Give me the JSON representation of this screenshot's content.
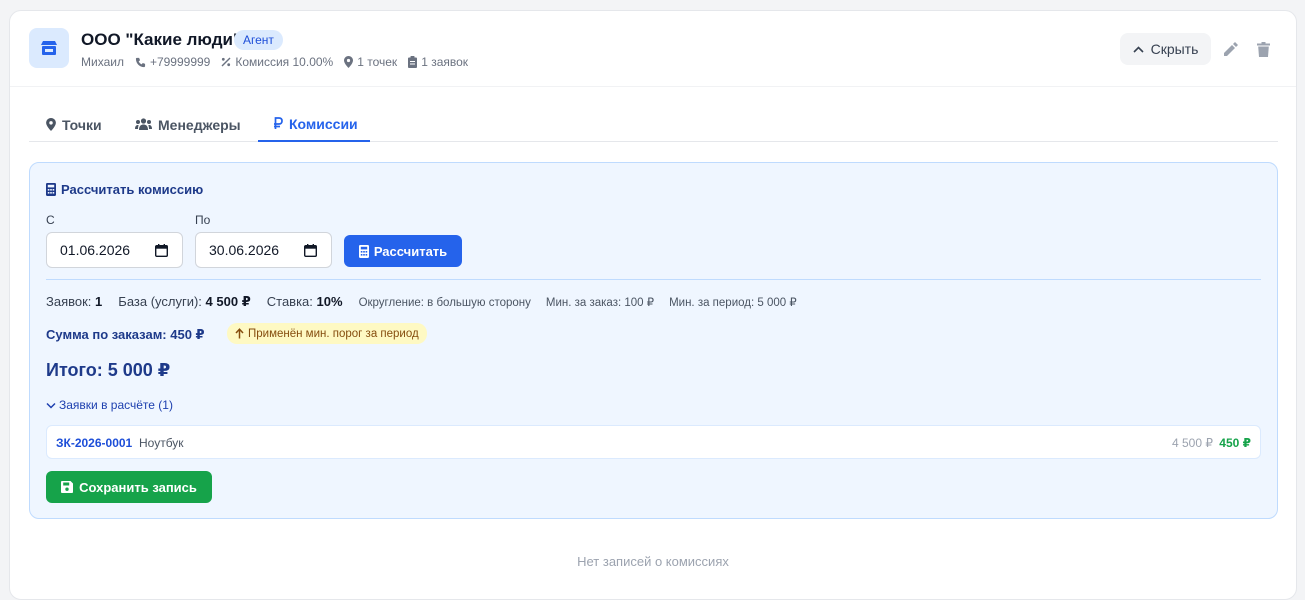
{
  "header": {
    "title": "ООО \"Какие люди\"",
    "badge": "Агент",
    "meta": {
      "contact": "Михаил",
      "phone": "+79999999",
      "commission": "Комиссия 10.00%",
      "points": "1 точек",
      "orders": "1 заявок"
    },
    "hide_label": "Скрыть"
  },
  "tabs": [
    {
      "label": "Точки",
      "icon": "map-pin-icon"
    },
    {
      "label": "Менеджеры",
      "icon": "users-icon"
    },
    {
      "label": "Комиссии",
      "icon": "ruble-icon",
      "active": true
    }
  ],
  "calc": {
    "title": "Рассчитать комиссию",
    "from_label": "С",
    "from_value": "01.06.2026",
    "to_label": "По",
    "to_value": "30.06.2026",
    "calc_button": "Рассчитать",
    "stats": {
      "orders_label": "Заявок:",
      "orders_value": "1",
      "base_label": "База (услуги):",
      "base_value": "4 500 ₽",
      "rate_label": "Ставка:",
      "rate_value": "10%",
      "rounding": "Округление: в большую сторону",
      "min_order": "Мин. за заказ: 100 ₽",
      "min_period": "Мин. за период: 5 000 ₽"
    },
    "sum_by_orders": "Сумма по заказам: 450 ₽",
    "note": "Применён мин. порог за период",
    "total": "Итого: 5 000 ₽",
    "orders_toggle": "Заявки в расчёте (1)",
    "orders": [
      {
        "id": "ЗК-2026-0001",
        "name": "Ноутбук",
        "base": "4 500 ₽",
        "commission": "450 ₽"
      }
    ],
    "save_button": "Сохранить запись"
  },
  "empty_text": "Нет записей о комиссиях",
  "colors": {
    "accent": "#2563eb",
    "success": "#16a34a",
    "panel_bg": "#eff6ff",
    "note_bg": "#fef9c3"
  }
}
